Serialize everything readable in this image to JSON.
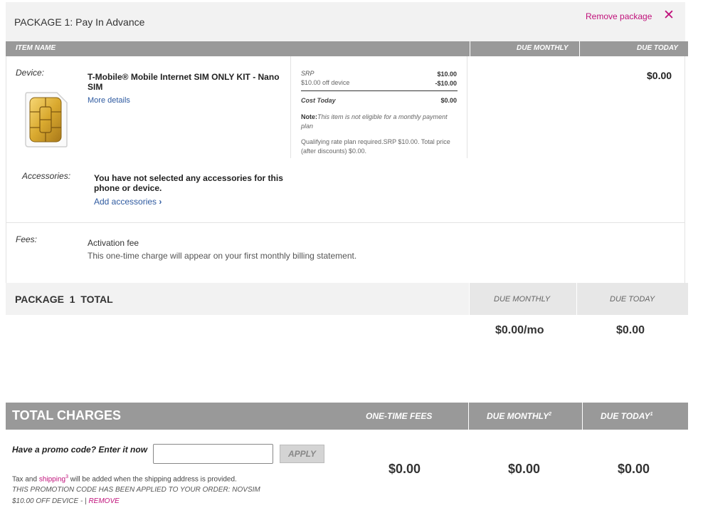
{
  "package": {
    "title": "PACKAGE 1: Pay In Advance",
    "remove_label": "Remove package",
    "close_glyph": "✕"
  },
  "columns": {
    "item_name": "ITEM NAME",
    "due_monthly": "DUE MONTHLY",
    "due_today": "DUE TODAY"
  },
  "device": {
    "label": "Device:",
    "name": "T-Mobile® Mobile Internet SIM ONLY KIT - Nano SIM",
    "more_details": "More details",
    "image_icon": "sim-card-icon",
    "srp_label": "SRP",
    "srp_value": "$10.00",
    "discount_label": "$10.00 off device",
    "discount_value": "-$10.00",
    "cost_today_label": "Cost Today",
    "cost_today_value": "$0.00",
    "note_label": "Note:",
    "note_text": "This item is not eligible for a monthly payment plan",
    "qualify_text": "Qualifying rate plan required.SRP $10.00. Total price (after discounts) $0.00.",
    "due_today": "$0.00"
  },
  "accessories": {
    "label": "Accessories:",
    "message": "You have not selected any accessories for this phone or device.",
    "add_link": "Add accessories",
    "add_chevron": "›"
  },
  "fees": {
    "label": "Fees:",
    "name": "Activation fee",
    "description": "This one-time charge will appear on your first monthly billing statement."
  },
  "package_total": {
    "title": "PACKAGE  1  TOTAL",
    "due_monthly_label": "DUE MONTHLY",
    "due_today_label": "DUE TODAY",
    "due_monthly_value": "$0.00/mo",
    "due_today_value": "$0.00"
  },
  "total_charges": {
    "title": "TOTAL CHARGES",
    "one_time_label": "ONE-TIME FEES",
    "due_monthly_label": "DUE MONTHLY",
    "due_monthly_sup": "2",
    "due_today_label": "DUE TODAY",
    "due_today_sup": "1",
    "one_time_value": "$0.00",
    "due_monthly_value": "$0.00",
    "due_today_value": "$0.00"
  },
  "promo": {
    "prompt": "Have a promo code? Enter it now",
    "input_value": "",
    "apply_label": "APPLY",
    "tax_prefix": "Tax and ",
    "shipping_link": "shipping",
    "shipping_sup": "3",
    "tax_suffix": " will be added when the shipping address is provided.",
    "applied_text": "THIS PROMOTION CODE HAS BEEN APPLIED TO YOUR ORDER: NOVSIM",
    "applied_detail": "$10.00 OFF DEVICE - | ",
    "remove_link": "REMOVE"
  },
  "colors": {
    "accent_magenta": "#c0127b",
    "header_gray": "#999999",
    "link_blue": "#2e5aa0"
  }
}
